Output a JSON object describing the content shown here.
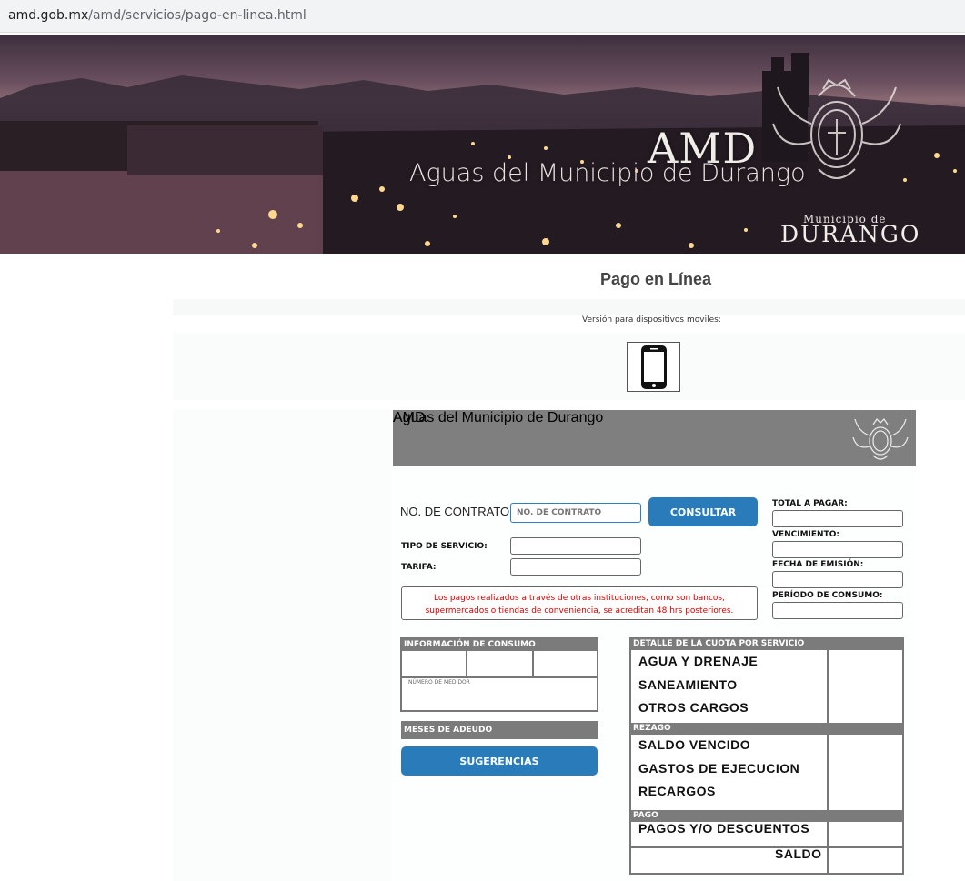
{
  "browser": {
    "url_host": "amd.gob.mx",
    "url_path": "/amd/servicios/pago-en-linea.html"
  },
  "hero": {
    "title": "AMD",
    "subtitle": "Aguas del Municipio de Durango",
    "municipio_small": "Municipio de",
    "municipio_big": "DURANGO"
  },
  "page": {
    "title": "Pago en Línea",
    "mobile_label": "Versión para dispositivos moviles:"
  },
  "form_header": {
    "title": "AMD",
    "subtitle": "Aguas del Municipio de Durango"
  },
  "form": {
    "contract_label": "NO. DE CONTRATO:",
    "contract_placeholder": "NO. DE CONTRATO",
    "consult_button": "CONSULTAR",
    "tipo_servicio_label": "TIPO DE SERVICIO:",
    "tarifa_label": "TARIFA:",
    "total_label": "TOTAL A PAGAR:",
    "vencimiento_label": "VENCIMIENTO:",
    "fecha_emision_label": "FECHA DE EMISIÓN:",
    "periodo_label": "PERÍODO DE CONSUMO:",
    "notice_line1": "Los pagos realizados a través de otras instituciones, como son bancos,",
    "notice_line2": "supermercados o tiendas de conveniencia, se acreditan 48 hrs posteriores."
  },
  "consumo": {
    "header": "INFORMACIÓN DE CONSUMO",
    "medidor_label": "NÚMERO DE MEDIDOR",
    "meses_header": "MESES DE ADEUDO",
    "sugerencias_button": "SUGERENCIAS"
  },
  "detalle": {
    "header": "DETALLE DE LA CUOTA POR SERVICIO",
    "items": [
      "AGUA Y DRENAJE",
      "SANEAMIENTO",
      "OTROS CARGOS"
    ],
    "rezago_header": "REZAGO",
    "rezago_items": [
      "SALDO VENCIDO",
      "GASTOS DE EJECUCION",
      "RECARGOS"
    ],
    "pago_header": "PAGO",
    "pago_items": [
      "PAGOS Y/O DESCUENTOS"
    ],
    "saldo_label": "SALDO"
  }
}
